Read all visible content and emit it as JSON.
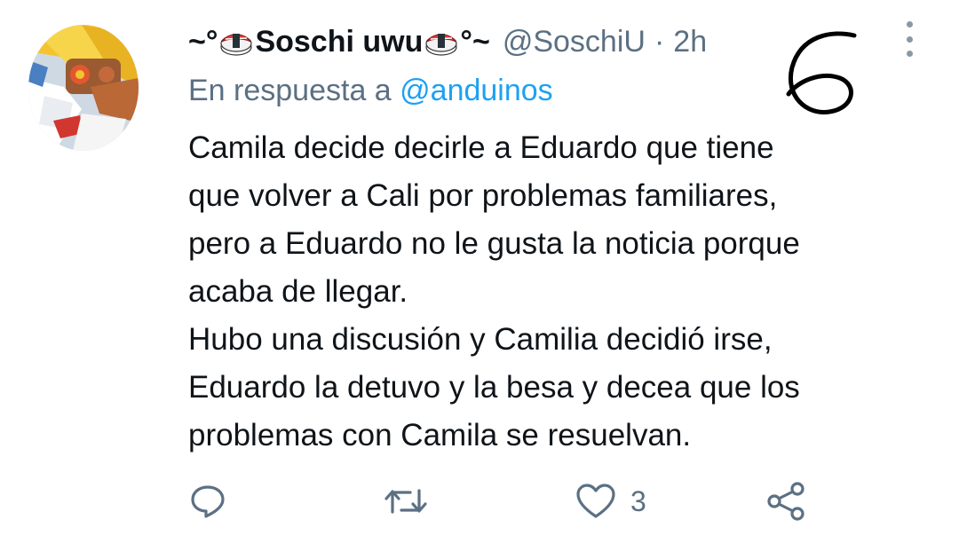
{
  "author": {
    "name": "Soschi uwu",
    "prefix": "~°",
    "suffix": "°~",
    "handle": "@SoschiU",
    "separator": "·",
    "time": "2h",
    "avatar_icon": "anime-character-avatar"
  },
  "reply": {
    "prefix": "En respuesta a ",
    "mention": "@anduinos"
  },
  "annotation": "6",
  "body_lines": [
    "Camila decide decirle a Eduardo que tiene",
    "que volver a Cali por problemas familiares,",
    "pero a Eduardo no le gusta la noticia porque",
    "acaba de llegar.",
    "Hubo una discusión y Camilia decidió irse,",
    "Eduardo la detuvo y la besa y decea que los",
    "problemas con Camila se resuelvan."
  ],
  "actions": {
    "reply_icon": "comment-icon",
    "retweet_icon": "retweet-icon",
    "like_icon": "heart-icon",
    "like_count": "3",
    "share_icon": "share-icon"
  },
  "colors": {
    "text": "#0f1419",
    "secondary": "#5b7083",
    "accent": "#1da1f2"
  }
}
